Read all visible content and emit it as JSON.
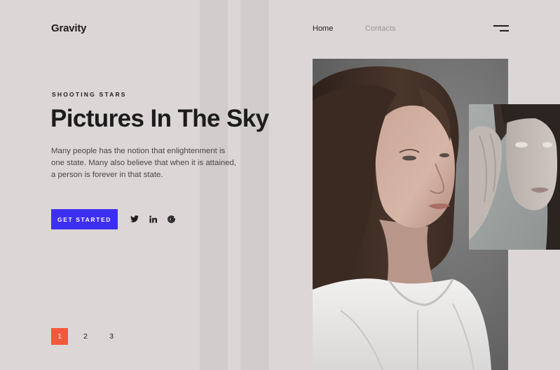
{
  "header": {
    "logo": "Gravity",
    "nav": [
      {
        "label": "Home"
      },
      {
        "label": "Contacts"
      }
    ],
    "menu_icon": "hamburger-menu-icon"
  },
  "hero": {
    "eyebrow": "SHOOTING STARS",
    "title": "Pictures In The Sky",
    "description": "Many people has the notion that enlightenment is one state. Many also believe that when it is attained, a person is forever in that state.",
    "cta_label": "GET STARTED"
  },
  "social": [
    {
      "icon": "twitter-icon"
    },
    {
      "icon": "linkedin-icon"
    },
    {
      "icon": "google-icon"
    }
  ],
  "pagination": {
    "pages": [
      "1",
      "2",
      "3"
    ],
    "active": "1"
  },
  "colors": {
    "background": "#dcd6d6",
    "accent_button": "#3d2ff0",
    "active_page": "#f4583b",
    "text": "#1c1c1c"
  }
}
